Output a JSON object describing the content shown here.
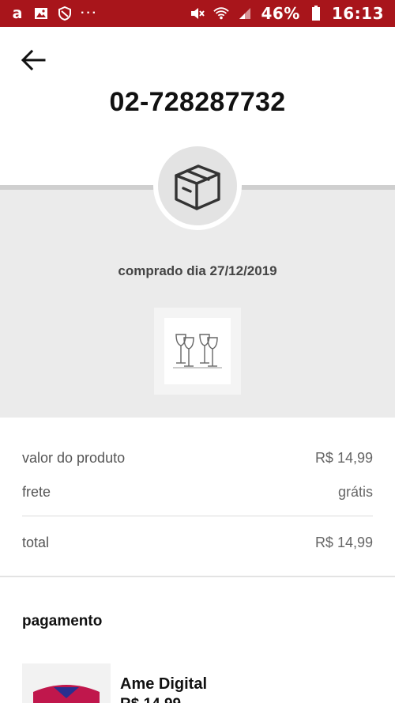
{
  "status_bar": {
    "battery": "46%",
    "time": "16:13",
    "icons": [
      "amazon-icon",
      "image-icon",
      "shield-icon",
      "more-dots-icon",
      "mute-icon",
      "wifi-icon",
      "signal-icon",
      "battery-icon"
    ]
  },
  "header": {
    "order_number": "02-728287732"
  },
  "order": {
    "purchase_date_label": "comprado dia 27/12/2019"
  },
  "summary": {
    "product_value_label": "valor do produto",
    "product_value": "R$ 14,99",
    "shipping_label": "frete",
    "shipping_value": "grátis",
    "total_label": "total",
    "total_value": "R$ 14,99"
  },
  "payment": {
    "title": "pagamento",
    "method_name": "Ame Digital",
    "method_amount": "R$ 14,99"
  },
  "colors": {
    "status_bar": "#a8151b",
    "band": "#ebebeb"
  }
}
